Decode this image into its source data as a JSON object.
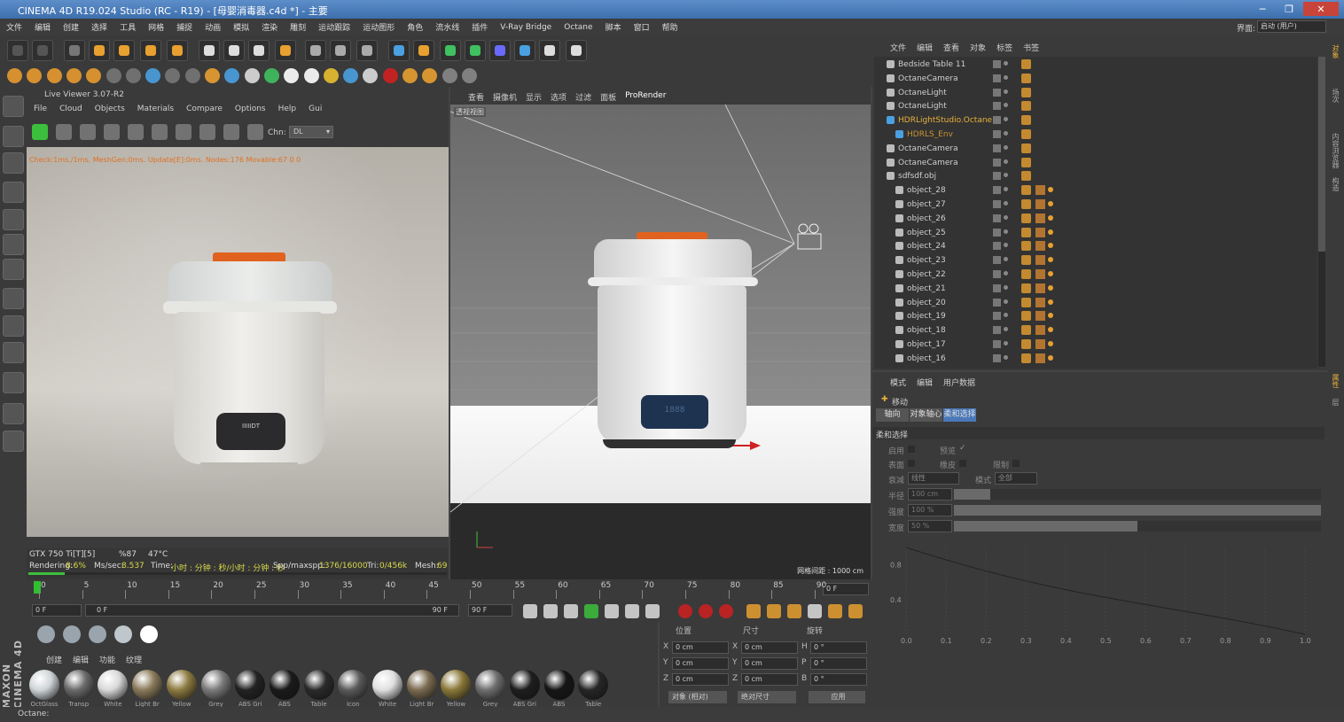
{
  "window": {
    "title": "CINEMA 4D R19.024 Studio (RC - R19) - [母婴消毒器.c4d *] - 主要",
    "layout_label": "界面:",
    "layout_value": "启动 (用户)"
  },
  "menubar": [
    "文件",
    "编辑",
    "创建",
    "选择",
    "工具",
    "网格",
    "捕捉",
    "动画",
    "模拟",
    "渲染",
    "雕刻",
    "运动跟踪",
    "运动图形",
    "角色",
    "流水线",
    "插件",
    "V-Ray Bridge",
    "Octane",
    "脚本",
    "窗口",
    "帮助"
  ],
  "live_viewer": {
    "title": "Live Viewer 3.07-R2",
    "menu": [
      "File",
      "Cloud",
      "Objects",
      "Materials",
      "Compare",
      "Options",
      "Help",
      "Gui"
    ],
    "chn_label": "Chn:",
    "chn_value": "DL",
    "status": "Check:1ms./1ms. MeshGen:0ms. Update[E]:0ms. Nodes:176 Movable:67  0 0",
    "gpu": "GTX 750 Ti[T][5]",
    "gpu_pct": "%87",
    "gpu_temp": "47°C",
    "rendering_label": "Rendering:",
    "rendering_value": "8.6%",
    "rendering_progress": 0.086,
    "ms_label": "Ms/sec:",
    "ms_value": "8.537",
    "time_label": "Time:",
    "time_value": "小时 : 分钟 : 秒/小时 : 分钟 : 秒",
    "spp_label": "Spp/maxspp:",
    "spp_value": "1376/16000",
    "tri_label": "Tri:",
    "tri_value": "0/456k",
    "mesh_label": "Mesh:",
    "mesh_value": "69",
    "display_text": "IIIIIDT"
  },
  "viewport": {
    "menu": [
      "查看",
      "摄像机",
      "显示",
      "选项",
      "过滤",
      "面板",
      "ProRender"
    ],
    "view_name": "透视视图",
    "grid_label": "网格间距 : 1000 cm",
    "display_text": "1888"
  },
  "timeline": {
    "ticks": [
      "0",
      "5",
      "10",
      "15",
      "20",
      "25",
      "30",
      "35",
      "40",
      "45",
      "50",
      "55",
      "60",
      "65",
      "70",
      "75",
      "80",
      "85",
      "90"
    ],
    "current_frame": "0 F",
    "start": "0 F",
    "range_start": "0 F",
    "range_end": "90 F",
    "end": "90 F"
  },
  "material_menu": [
    "创建",
    "编辑",
    "功能",
    "纹理"
  ],
  "materials": [
    {
      "name": "OctGlass",
      "color": "#cfd5d8"
    },
    {
      "name": "Transp",
      "color": "#6a6a6a"
    },
    {
      "name": "White",
      "color": "#d8d8d8"
    },
    {
      "name": "Light Br",
      "color": "#8a7a5a"
    },
    {
      "name": "Yellow",
      "color": "#8c7a40"
    },
    {
      "name": "Grey",
      "color": "#7a7a7a"
    },
    {
      "name": "ABS Gri",
      "color": "#222222"
    },
    {
      "name": "ABS",
      "color": "#1a1a1a"
    },
    {
      "name": "Table",
      "color": "#2a2a2a"
    },
    {
      "name": "Icon",
      "color": "#5a5a5a"
    },
    {
      "name": "White",
      "color": "#e0e0e0"
    },
    {
      "name": "Light Br",
      "color": "#7a6a50"
    },
    {
      "name": "Yellow",
      "color": "#8a7838"
    },
    {
      "name": "Grey",
      "color": "#6e6e6e"
    },
    {
      "name": "ABS Gri",
      "color": "#1e1e1e"
    },
    {
      "name": "ABS",
      "color": "#151515"
    },
    {
      "name": "Table",
      "color": "#262626"
    }
  ],
  "coords": {
    "headers": [
      "位置",
      "尺寸",
      "旋转"
    ],
    "rows": [
      {
        "axis": "X",
        "pos": "0 cm",
        "size_axis": "X",
        "size": "0 cm",
        "rot_axis": "H",
        "rot": "0 °"
      },
      {
        "axis": "Y",
        "pos": "0 cm",
        "size_axis": "Y",
        "size": "0 cm",
        "rot_axis": "P",
        "rot": "0 °"
      },
      {
        "axis": "Z",
        "pos": "0 cm",
        "size_axis": "Z",
        "size": "0 cm",
        "rot_axis": "B",
        "rot": "0 °"
      }
    ],
    "mode1": "对象 (相对)",
    "mode2": "绝对尺寸",
    "apply": "应用"
  },
  "object_manager": {
    "menu": [
      "文件",
      "编辑",
      "查看",
      "对象",
      "标签",
      "书签"
    ],
    "rows": [
      {
        "name": "Bedside Table 11",
        "indent": 0,
        "color": "#cfcfcf"
      },
      {
        "name": "OctaneCamera",
        "indent": 0,
        "color": "#cfcfcf"
      },
      {
        "name": "OctaneLight",
        "indent": 0,
        "color": "#cfcfcf"
      },
      {
        "name": "OctaneLight",
        "indent": 0,
        "color": "#cfcfcf"
      },
      {
        "name": "HDRLightStudio.Octane",
        "indent": 0,
        "color": "#e8b23a"
      },
      {
        "name": "HDRLS_Env",
        "indent": 1,
        "color": "#c89530"
      },
      {
        "name": "OctaneCamera",
        "indent": 0,
        "color": "#cfcfcf"
      },
      {
        "name": "OctaneCamera",
        "indent": 0,
        "color": "#cfcfcf"
      },
      {
        "name": "sdfsdf.obj",
        "indent": 0,
        "color": "#cfcfcf"
      },
      {
        "name": "object_28",
        "indent": 1,
        "color": "#cfcfcf"
      },
      {
        "name": "object_27",
        "indent": 1,
        "color": "#cfcfcf"
      },
      {
        "name": "object_26",
        "indent": 1,
        "color": "#cfcfcf"
      },
      {
        "name": "object_25",
        "indent": 1,
        "color": "#cfcfcf"
      },
      {
        "name": "object_24",
        "indent": 1,
        "color": "#cfcfcf"
      },
      {
        "name": "object_23",
        "indent": 1,
        "color": "#cfcfcf"
      },
      {
        "name": "object_22",
        "indent": 1,
        "color": "#cfcfcf"
      },
      {
        "name": "object_21",
        "indent": 1,
        "color": "#cfcfcf"
      },
      {
        "name": "object_20",
        "indent": 1,
        "color": "#cfcfcf"
      },
      {
        "name": "object_19",
        "indent": 1,
        "color": "#cfcfcf"
      },
      {
        "name": "object_18",
        "indent": 1,
        "color": "#cfcfcf"
      },
      {
        "name": "object_17",
        "indent": 1,
        "color": "#cfcfcf"
      },
      {
        "name": "object_16",
        "indent": 1,
        "color": "#cfcfcf"
      }
    ]
  },
  "attributes": {
    "menu": [
      "模式",
      "编辑",
      "用户数据"
    ],
    "tool_name": "移动",
    "tabs": [
      "轴向",
      "对象轴心",
      "柔和选择"
    ],
    "section": "柔和选择",
    "enable_label": "启用",
    "preview_label": "预览",
    "surface_label": "表面",
    "rubber_label": "橡皮",
    "limit_label": "限制",
    "falloff_label": "衰减",
    "falloff_value": "线性",
    "mode_label": "模式",
    "mode_value": "全部",
    "radius_label": "半径",
    "radius_value": "100 cm",
    "radius_fill": 0.1,
    "strength_label": "强度",
    "strength_value": "100 %",
    "strength_fill": 1.0,
    "width_label": "宽度",
    "width_value": "50 %",
    "width_fill": 0.5,
    "graph_y": [
      "0.8",
      "0.4"
    ],
    "graph_x": [
      "0.0",
      "0.1",
      "0.2",
      "0.3",
      "0.4",
      "0.5",
      "0.6",
      "0.7",
      "0.8",
      "0.9",
      "1.0"
    ]
  },
  "statusbar": "Octane:",
  "right_tabs": [
    "对象",
    "场次",
    "内容浏览器",
    "构造"
  ],
  "right_tabs2": [
    "属性",
    "层"
  ],
  "brand": "MAXON CINEMA 4D"
}
